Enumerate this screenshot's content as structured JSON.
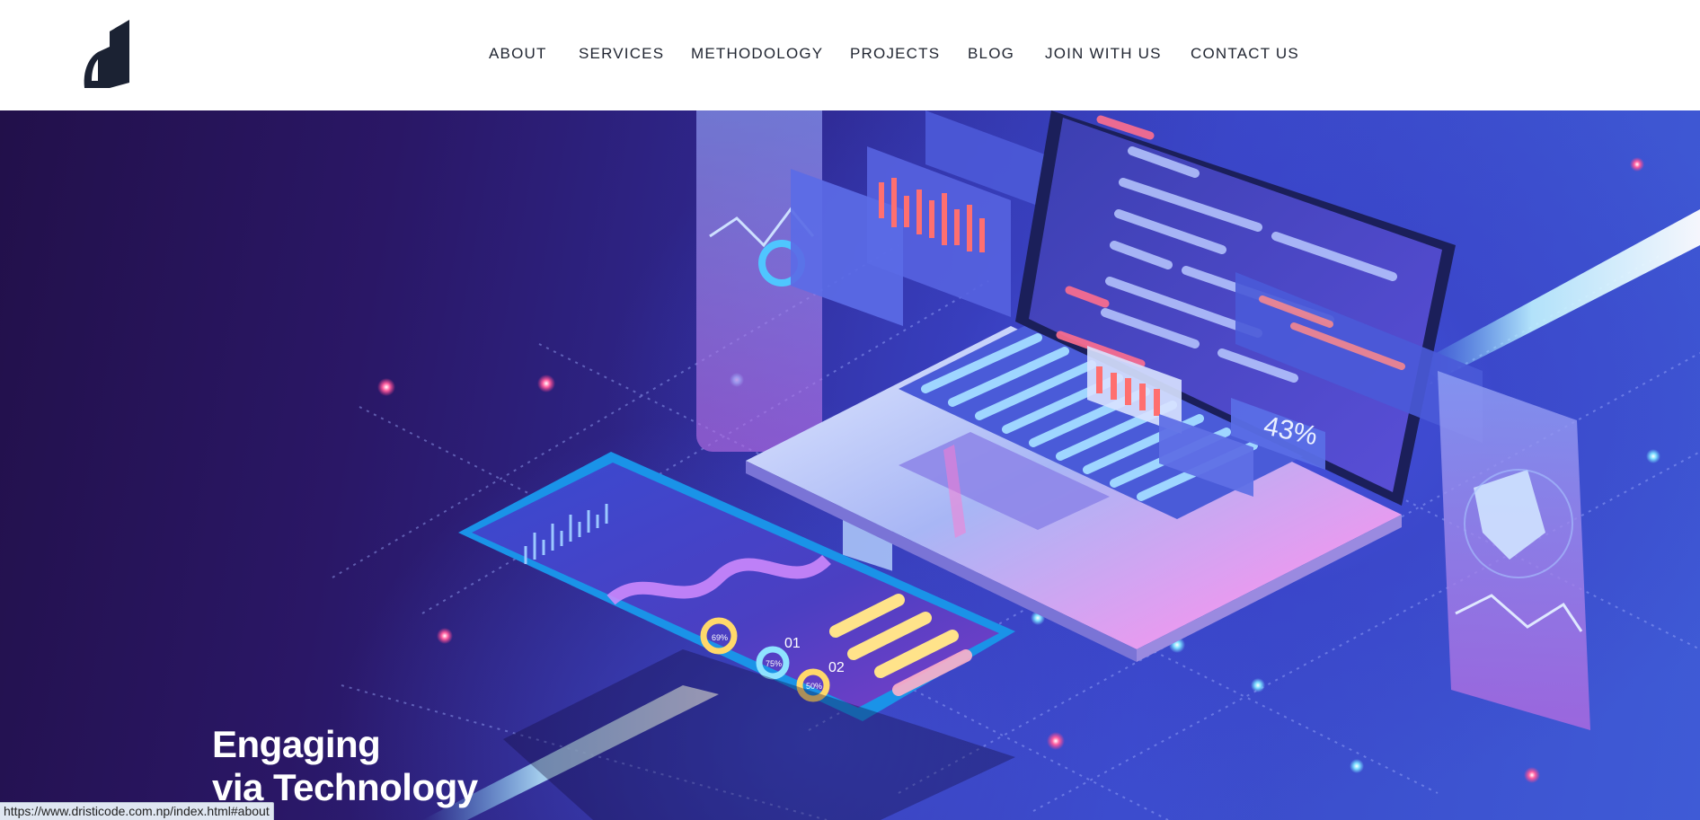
{
  "brand": {
    "logo_icon": "d-letter-logo",
    "logo_color": "#1b2233"
  },
  "nav": {
    "items": [
      {
        "label": "ABOUT"
      },
      {
        "label": "SERVICES"
      },
      {
        "label": "METHODOLOGY"
      },
      {
        "label": "PROJECTS"
      },
      {
        "label": "BLOG"
      },
      {
        "label": "JOIN WITH US"
      },
      {
        "label": "CONTACT US"
      }
    ]
  },
  "hero": {
    "title_line1": "Engaging",
    "title_line2": "via Technology",
    "illustration": {
      "laptop_badge": "43%",
      "phone_ring_labels": [
        "69%",
        "75%",
        "50%"
      ],
      "phone_step_labels": [
        "01",
        "02"
      ]
    },
    "colors": {
      "deep_purple": "#22104a",
      "indigo": "#2f2a94",
      "blue": "#3f5bd6",
      "glow": "#6fd8ff",
      "accent_pink": "#ff3c8a"
    }
  },
  "status_bar": {
    "url": "https://www.dristicode.com.np/index.html#about"
  }
}
